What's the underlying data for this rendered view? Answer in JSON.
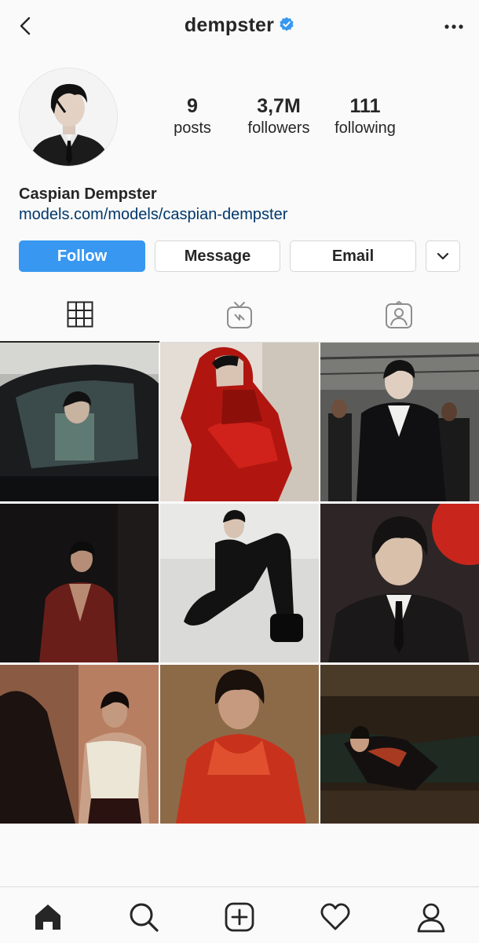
{
  "header": {
    "username": "dempster",
    "verified": true,
    "back_icon": "chevron-left-icon",
    "more_icon": "more-horizontal-icon"
  },
  "profile": {
    "posts": {
      "value": "9",
      "label": "posts"
    },
    "followers": {
      "value": "3,7M",
      "label": "followers"
    },
    "following": {
      "value": "111",
      "label": "following"
    },
    "full_name": "Caspian Dempster",
    "website": "models.com/models/caspian-dempster"
  },
  "actions": {
    "follow_label": "Follow",
    "message_label": "Message",
    "email_label": "Email",
    "dropdown_icon": "chevron-down-icon"
  },
  "tabs": [
    {
      "name": "grid",
      "icon": "grid-icon",
      "active": true
    },
    {
      "name": "igtv",
      "icon": "igtv-icon",
      "active": false
    },
    {
      "name": "tagged",
      "icon": "tagged-user-icon",
      "active": false
    }
  ],
  "grid_posts": [
    {
      "description": "car-window-portrait"
    },
    {
      "description": "red-vinyl-hood"
    },
    {
      "description": "backstage-black-suit"
    },
    {
      "description": "red-blazer-dark"
    },
    {
      "description": "black-outfit-seated"
    },
    {
      "description": "red-balloon-suit"
    },
    {
      "description": "white-tank-top"
    },
    {
      "description": "red-jacket-closeup"
    },
    {
      "description": "reclining-dark-room"
    }
  ],
  "bottom_nav": [
    {
      "name": "home",
      "icon": "home-icon"
    },
    {
      "name": "search",
      "icon": "search-icon"
    },
    {
      "name": "new-post",
      "icon": "add-post-icon"
    },
    {
      "name": "activity",
      "icon": "heart-icon"
    },
    {
      "name": "profile",
      "icon": "profile-icon"
    }
  ],
  "colors": {
    "accent": "#3897f0",
    "link": "#00376b",
    "text": "#262626",
    "background": "#fafafa",
    "border": "#dbdbdb"
  }
}
